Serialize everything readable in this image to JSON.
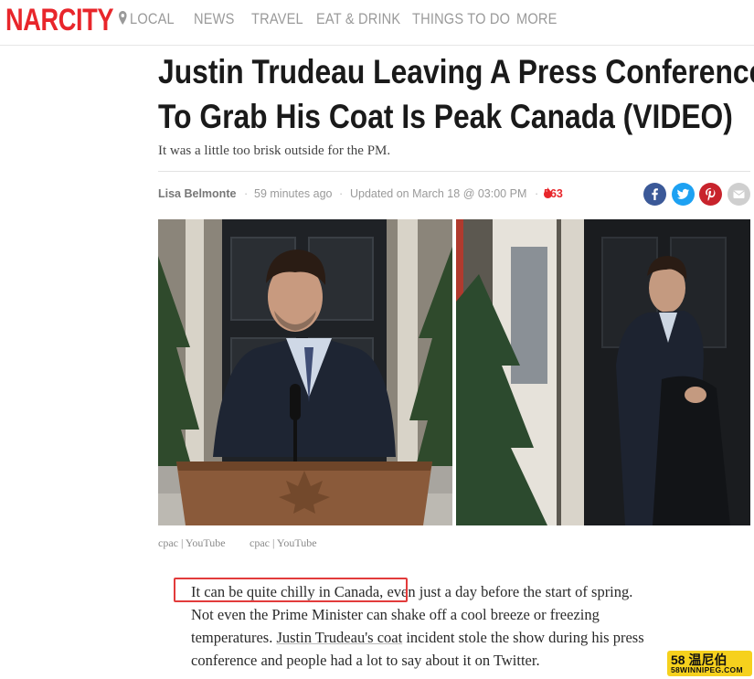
{
  "site": {
    "logo": "NARCITY",
    "nav": [
      {
        "label": "LOCAL",
        "icon": "location-pin-icon"
      },
      {
        "label": "NEWS"
      },
      {
        "label": "TRAVEL"
      },
      {
        "label": "EAT & DRINK"
      },
      {
        "label": "THINGS TO DO"
      },
      {
        "label": "MORE"
      }
    ]
  },
  "article": {
    "headline_line1": "Justin Trudeau Leaving A Press Conference",
    "headline_line2": "To Grab His Coat Is Peak Canada (VIDEO)",
    "subtitle": "It was a little too brisk outside for the PM.",
    "author": "Lisa Belmonte",
    "published": "59 minutes ago",
    "updated": "Updated on March 18 @ 03:00 PM",
    "hot_count": "563",
    "share_buttons": [
      {
        "icon": "facebook-icon",
        "color": "#3b5998"
      },
      {
        "icon": "twitter-icon",
        "color": "#1da1f2"
      },
      {
        "icon": "pinterest-icon",
        "color": "#c8232c"
      },
      {
        "icon": "email-icon",
        "color": "#cfcfcf"
      }
    ],
    "image_credits": [
      "cpac | YouTube",
      "cpac | YouTube"
    ],
    "body": {
      "highlighted": "It can be quite chilly in Canada,",
      "line1_rest": " even just a day before the start of spring.",
      "line2": "Not even the Prime Minister can shake off a cool breeze or freezing",
      "line3_pre": "temperatures. ",
      "line3_link": "Justin Trudeau's coat",
      "line3_post": " incident stole the show during his press",
      "line4": "conference and people had a lot to say about it on Twitter."
    }
  },
  "watermark": {
    "top": "58 温尼伯",
    "bottom": "58WINNIPEG.COM"
  },
  "colors": {
    "brand_red": "#e8262b",
    "nav_gray": "#9a9a9a",
    "highlight_red": "#e23b3b",
    "watermark_yellow": "#f6d11d"
  }
}
